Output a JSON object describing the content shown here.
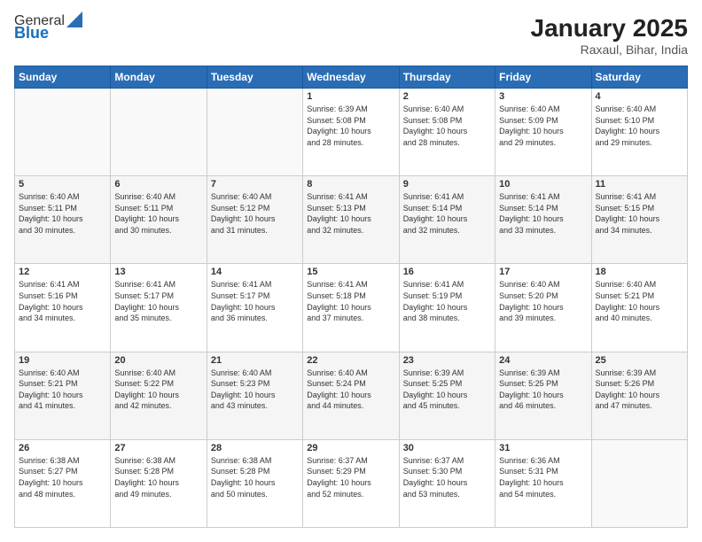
{
  "logo": {
    "general": "General",
    "blue": "Blue"
  },
  "title": {
    "main": "January 2025",
    "sub": "Raxaul, Bihar, India"
  },
  "days_header": [
    "Sunday",
    "Monday",
    "Tuesday",
    "Wednesday",
    "Thursday",
    "Friday",
    "Saturday"
  ],
  "weeks": [
    [
      {
        "num": "",
        "info": ""
      },
      {
        "num": "",
        "info": ""
      },
      {
        "num": "",
        "info": ""
      },
      {
        "num": "1",
        "info": "Sunrise: 6:39 AM\nSunset: 5:08 PM\nDaylight: 10 hours\nand 28 minutes."
      },
      {
        "num": "2",
        "info": "Sunrise: 6:40 AM\nSunset: 5:08 PM\nDaylight: 10 hours\nand 28 minutes."
      },
      {
        "num": "3",
        "info": "Sunrise: 6:40 AM\nSunset: 5:09 PM\nDaylight: 10 hours\nand 29 minutes."
      },
      {
        "num": "4",
        "info": "Sunrise: 6:40 AM\nSunset: 5:10 PM\nDaylight: 10 hours\nand 29 minutes."
      }
    ],
    [
      {
        "num": "5",
        "info": "Sunrise: 6:40 AM\nSunset: 5:11 PM\nDaylight: 10 hours\nand 30 minutes."
      },
      {
        "num": "6",
        "info": "Sunrise: 6:40 AM\nSunset: 5:11 PM\nDaylight: 10 hours\nand 30 minutes."
      },
      {
        "num": "7",
        "info": "Sunrise: 6:40 AM\nSunset: 5:12 PM\nDaylight: 10 hours\nand 31 minutes."
      },
      {
        "num": "8",
        "info": "Sunrise: 6:41 AM\nSunset: 5:13 PM\nDaylight: 10 hours\nand 32 minutes."
      },
      {
        "num": "9",
        "info": "Sunrise: 6:41 AM\nSunset: 5:14 PM\nDaylight: 10 hours\nand 32 minutes."
      },
      {
        "num": "10",
        "info": "Sunrise: 6:41 AM\nSunset: 5:14 PM\nDaylight: 10 hours\nand 33 minutes."
      },
      {
        "num": "11",
        "info": "Sunrise: 6:41 AM\nSunset: 5:15 PM\nDaylight: 10 hours\nand 34 minutes."
      }
    ],
    [
      {
        "num": "12",
        "info": "Sunrise: 6:41 AM\nSunset: 5:16 PM\nDaylight: 10 hours\nand 34 minutes."
      },
      {
        "num": "13",
        "info": "Sunrise: 6:41 AM\nSunset: 5:17 PM\nDaylight: 10 hours\nand 35 minutes."
      },
      {
        "num": "14",
        "info": "Sunrise: 6:41 AM\nSunset: 5:17 PM\nDaylight: 10 hours\nand 36 minutes."
      },
      {
        "num": "15",
        "info": "Sunrise: 6:41 AM\nSunset: 5:18 PM\nDaylight: 10 hours\nand 37 minutes."
      },
      {
        "num": "16",
        "info": "Sunrise: 6:41 AM\nSunset: 5:19 PM\nDaylight: 10 hours\nand 38 minutes."
      },
      {
        "num": "17",
        "info": "Sunrise: 6:40 AM\nSunset: 5:20 PM\nDaylight: 10 hours\nand 39 minutes."
      },
      {
        "num": "18",
        "info": "Sunrise: 6:40 AM\nSunset: 5:21 PM\nDaylight: 10 hours\nand 40 minutes."
      }
    ],
    [
      {
        "num": "19",
        "info": "Sunrise: 6:40 AM\nSunset: 5:21 PM\nDaylight: 10 hours\nand 41 minutes."
      },
      {
        "num": "20",
        "info": "Sunrise: 6:40 AM\nSunset: 5:22 PM\nDaylight: 10 hours\nand 42 minutes."
      },
      {
        "num": "21",
        "info": "Sunrise: 6:40 AM\nSunset: 5:23 PM\nDaylight: 10 hours\nand 43 minutes."
      },
      {
        "num": "22",
        "info": "Sunrise: 6:40 AM\nSunset: 5:24 PM\nDaylight: 10 hours\nand 44 minutes."
      },
      {
        "num": "23",
        "info": "Sunrise: 6:39 AM\nSunset: 5:25 PM\nDaylight: 10 hours\nand 45 minutes."
      },
      {
        "num": "24",
        "info": "Sunrise: 6:39 AM\nSunset: 5:25 PM\nDaylight: 10 hours\nand 46 minutes."
      },
      {
        "num": "25",
        "info": "Sunrise: 6:39 AM\nSunset: 5:26 PM\nDaylight: 10 hours\nand 47 minutes."
      }
    ],
    [
      {
        "num": "26",
        "info": "Sunrise: 6:38 AM\nSunset: 5:27 PM\nDaylight: 10 hours\nand 48 minutes."
      },
      {
        "num": "27",
        "info": "Sunrise: 6:38 AM\nSunset: 5:28 PM\nDaylight: 10 hours\nand 49 minutes."
      },
      {
        "num": "28",
        "info": "Sunrise: 6:38 AM\nSunset: 5:28 PM\nDaylight: 10 hours\nand 50 minutes."
      },
      {
        "num": "29",
        "info": "Sunrise: 6:37 AM\nSunset: 5:29 PM\nDaylight: 10 hours\nand 52 minutes."
      },
      {
        "num": "30",
        "info": "Sunrise: 6:37 AM\nSunset: 5:30 PM\nDaylight: 10 hours\nand 53 minutes."
      },
      {
        "num": "31",
        "info": "Sunrise: 6:36 AM\nSunset: 5:31 PM\nDaylight: 10 hours\nand 54 minutes."
      },
      {
        "num": "",
        "info": ""
      }
    ]
  ]
}
